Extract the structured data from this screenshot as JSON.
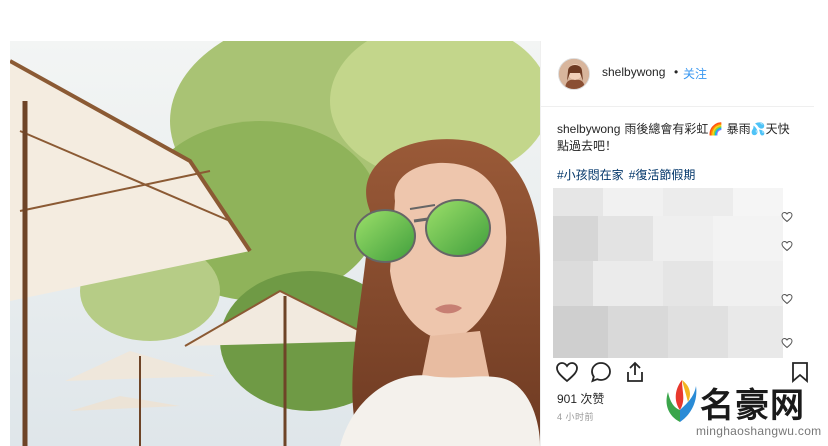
{
  "post": {
    "username": "shelbywong",
    "separator": "•",
    "follow_label": "关注",
    "caption_user": "shelbywong",
    "caption_text": "雨後總會有彩虹🌈 暴雨💦天快點過去吧！",
    "hashtags": [
      "#小孩悶在家",
      "#復活節假期"
    ],
    "likes": "901 次赞",
    "time": "4 小时前"
  },
  "icons": {
    "like": "heart-outline-icon",
    "comment": "comment-bubble-icon",
    "share": "share-upload-icon",
    "save": "bookmark-icon",
    "comment_like": "small-heart-icon"
  },
  "watermark": {
    "title": "名豪网",
    "url": "minghaoshangwu.com"
  },
  "colors": {
    "link": "#3897f0",
    "hashtag": "#003569",
    "text": "#262626",
    "muted": "#999999"
  }
}
